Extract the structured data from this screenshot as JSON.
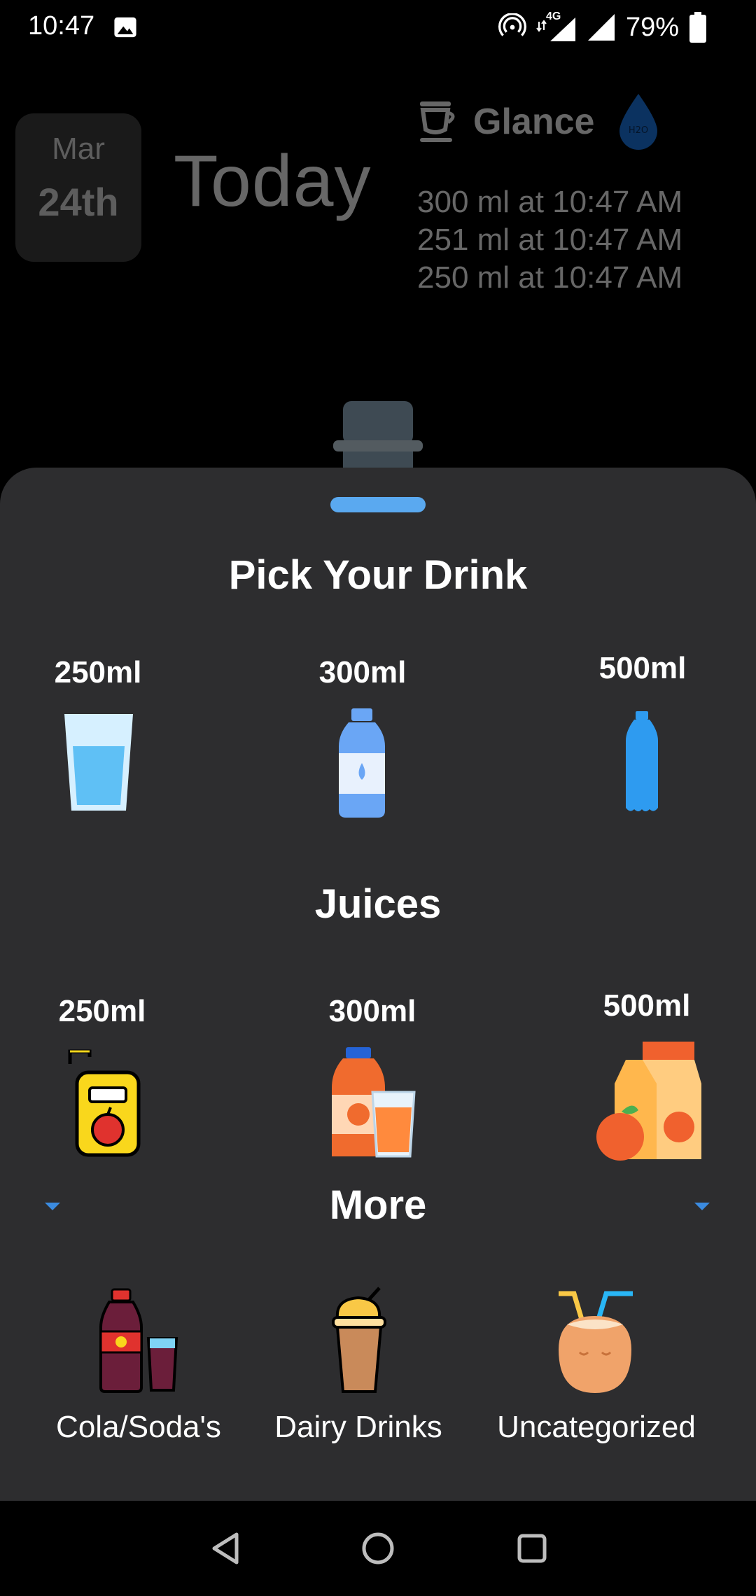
{
  "status_bar": {
    "time": "10:47",
    "network": "4G",
    "battery": "79%"
  },
  "header": {
    "month": "Mar",
    "day": "24th",
    "title": "Today",
    "glance_title": "Glance",
    "water_drop_label": "H2O",
    "log": [
      "300 ml at  10:47 AM",
      "251 ml at  10:47 AM",
      "250 ml at  10:47 AM"
    ]
  },
  "sheet": {
    "title": "Pick Your Drink",
    "water": [
      {
        "label": "250ml",
        "icon": "water-glass-icon"
      },
      {
        "label": "300ml",
        "icon": "water-bottle-icon"
      },
      {
        "label": "500ml",
        "icon": "tall-bottle-icon"
      }
    ],
    "juices_title": "Juices",
    "juices": [
      {
        "label": "250ml",
        "icon": "juice-box-icon"
      },
      {
        "label": "300ml",
        "icon": "orange-juice-bottle-icon"
      },
      {
        "label": "500ml",
        "icon": "orange-carton-icon"
      }
    ],
    "more_title": "More",
    "more": [
      {
        "label": "Cola/Soda's",
        "icon": "cola-icon"
      },
      {
        "label": "Dairy Drinks",
        "icon": "milkshake-icon"
      },
      {
        "label": "Uncategorized",
        "icon": "coconut-icon"
      }
    ]
  },
  "colors": {
    "sheet_bg": "#2d2d2f",
    "accent": "#5aa9f0"
  }
}
